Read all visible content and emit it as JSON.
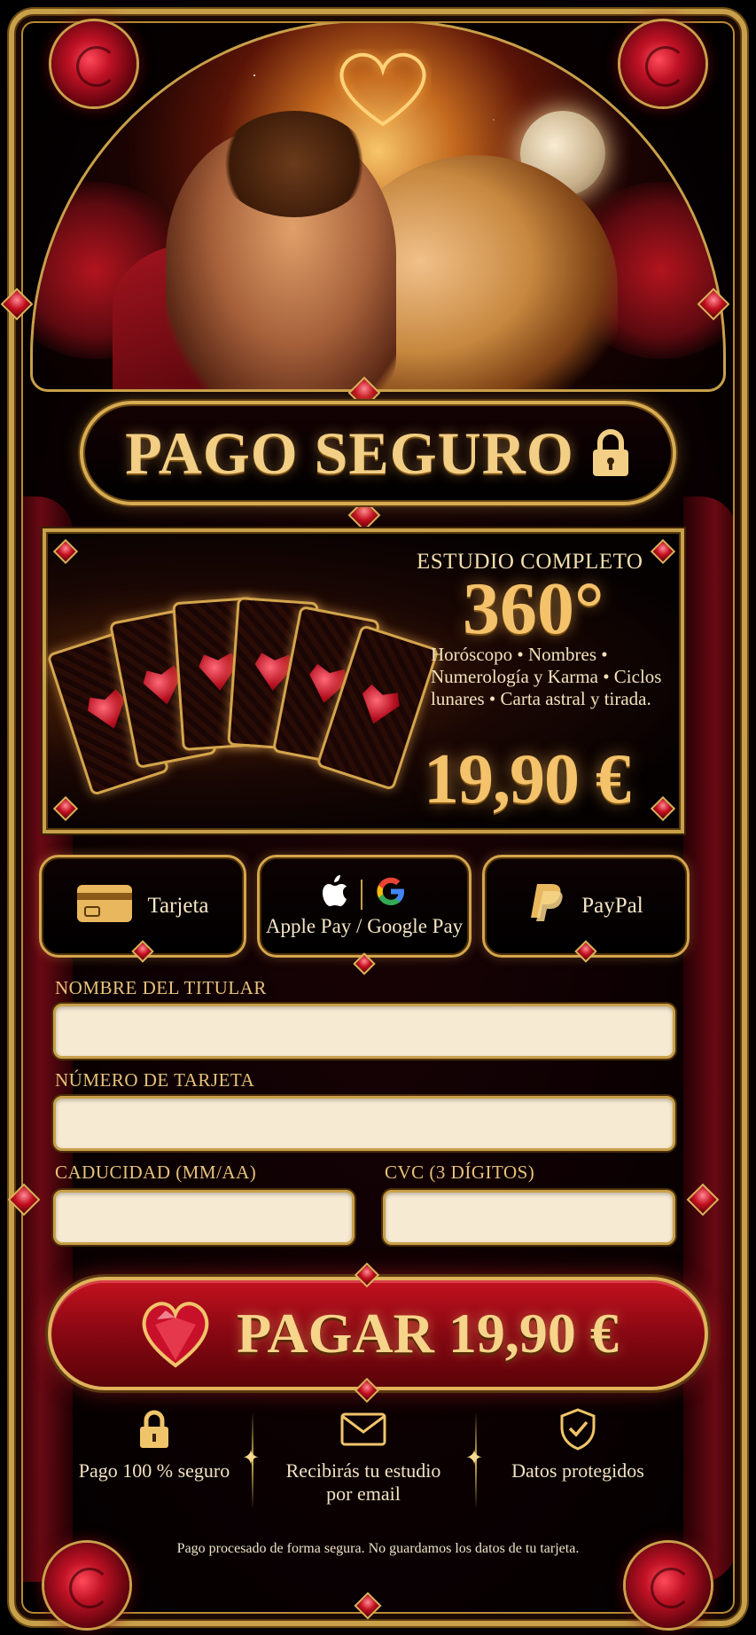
{
  "banner": {
    "title": "PAGO SEGURO"
  },
  "product": {
    "title": "ESTUDIO COMPLETO",
    "degree": "360°",
    "description": "Horóscopo • Nombres • Numerología y Karma • Ciclos lunares • Carta astral y tirada.",
    "price": "19,90 €"
  },
  "methods": {
    "card": "Tarjeta",
    "wallet": "Apple Pay / Google Pay",
    "paypal": "PayPal"
  },
  "form": {
    "name_label": "NOMBRE DEL TITULAR",
    "name_value": "",
    "number_label": "NÚMERO DE TARJETA",
    "number_value": "",
    "expiry_label": "CADUCIDAD (MM/AA)",
    "expiry_value": "",
    "cvc_label": "CVC (3 DÍGITOS)",
    "cvc_value": ""
  },
  "pay_button": {
    "label": "PAGAR 19,90 €"
  },
  "trust": {
    "secure": "Pago 100 % seguro",
    "email": "Recibirás tu estudio por email",
    "data": "Datos protegidos"
  },
  "footer": {
    "note": "Pago procesado de forma segura. No guardamos los datos de tu tarjeta."
  },
  "colors": {
    "gold": "#d4a54c",
    "crimson": "#a30f1c",
    "cream": "#f6ead3"
  }
}
